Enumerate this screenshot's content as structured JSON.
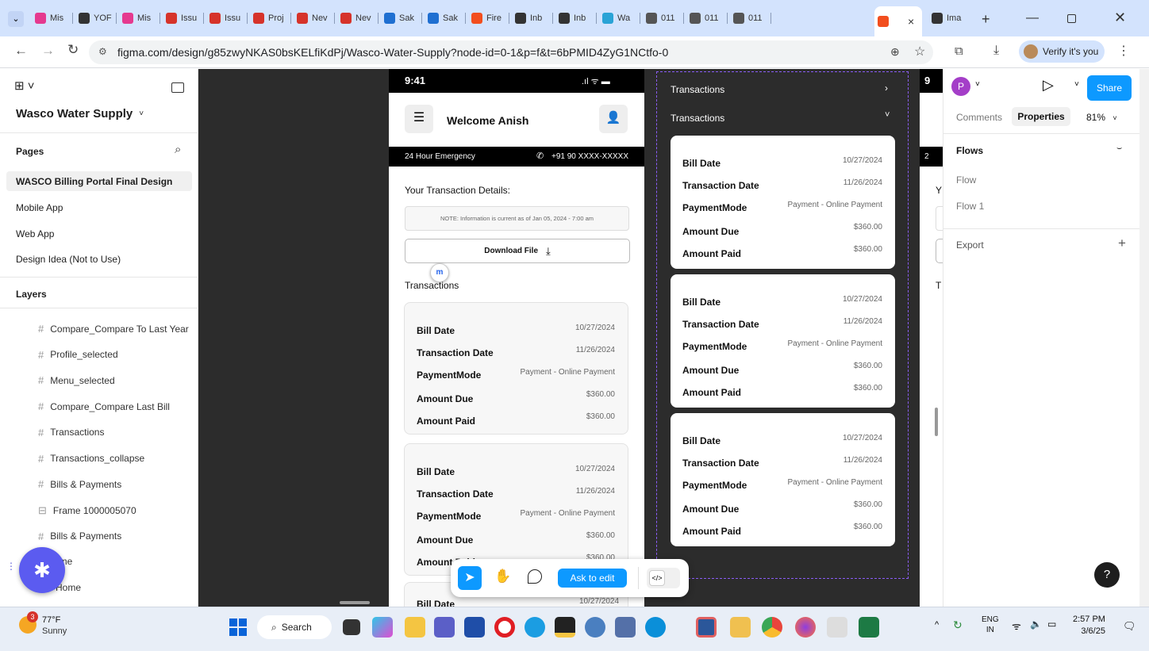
{
  "browser": {
    "tabs": [
      {
        "label": "Mis",
        "color": "#e5398f"
      },
      {
        "label": "YOF",
        "color": "#333333"
      },
      {
        "label": "Mis",
        "color": "#e5398f"
      },
      {
        "label": "Issu",
        "color": "#d6332a"
      },
      {
        "label": "Issu",
        "color": "#d6332a"
      },
      {
        "label": "Proj",
        "color": "#d6332a"
      },
      {
        "label": "Nev",
        "color": "#d6332a"
      },
      {
        "label": "Nev",
        "color": "#d6332a"
      },
      {
        "label": "Sak",
        "color": "#1f6fd1"
      },
      {
        "label": "Sak",
        "color": "#1f6fd1"
      },
      {
        "label": "Fire",
        "color": "#f24e1e"
      },
      {
        "label": "Inb",
        "color": "#333333"
      },
      {
        "label": "Inb",
        "color": "#333333"
      },
      {
        "label": "Wa",
        "color": "#2aa3d6"
      },
      {
        "label": "011",
        "color": "#555555"
      },
      {
        "label": "011",
        "color": "#555555"
      },
      {
        "label": "011",
        "color": "#555555"
      },
      {
        "label": "",
        "color": "#f24e1e"
      },
      {
        "label": "Ima",
        "color": "#333333"
      }
    ],
    "active_tab_close": "×",
    "new_tab": "+",
    "url": "figma.com/design/g85zwyNKAS0bsKELfiKdPj/Wasco-Water-Supply?node-id=0-1&p=f&t=6bPMID4ZyG1NCtfo-0",
    "verify_label": "Verify it's you"
  },
  "left_panel": {
    "file_name": "Wasco Water Supply",
    "pages_label": "Pages",
    "pages": [
      "WASCO Billing Portal Final Design",
      "Mobile App",
      "Web App",
      "Design Idea (Not to Use)"
    ],
    "layers_label": "Layers",
    "layers": [
      "Compare_Compare To Last Year",
      "Profile_selected",
      "Menu_selected",
      "Compare_Compare Last Bill",
      "Transactions",
      "Transactions_collapse",
      "Bills & Payments",
      "Frame 1000005070",
      "Bills & Payments",
      "ome",
      "Home"
    ]
  },
  "phone": {
    "time": "9:41",
    "welcome": "Welcome Anish",
    "emergency_label": "24 Hour Emergency",
    "emergency_phone": "+91 90 XXXX-XXXXX",
    "section_title": "Your Transaction Details:",
    "note": "NOTE: Information is current as of Jan 05, 2024 - 7:00 am",
    "download_label": "Download File",
    "transactions_label": "Transactions",
    "cards": [
      {
        "bill_date_label": "Bill Date",
        "bill_date": "10/27/2024",
        "txn_date_label": "Transaction Date",
        "txn_date": "11/26/2024",
        "mode_label": "PaymentMode",
        "mode": "Payment - Online Payment",
        "due_label": "Amount Due",
        "due": "$360.00",
        "paid_label": "Amount Paid",
        "paid": "$360.00"
      },
      {
        "bill_date_label": "Bill Date",
        "bill_date": "10/27/2024",
        "txn_date_label": "Transaction Date",
        "txn_date": "11/26/2024",
        "mode_label": "PaymentMode",
        "mode": "Payment - Online Payment",
        "due_label": "Amount Due",
        "due": "$360.00",
        "paid_label": "Amount Paid",
        "paid": "$360.00"
      }
    ],
    "partial_bill_label": "Bill Date",
    "partial_bill_date": "10/27/2024"
  },
  "frame2": {
    "header1": "Transactions",
    "header2": "Transactions",
    "cards": [
      {
        "bill_date_label": "Bill Date",
        "bill_date": "10/27/2024",
        "txn_date_label": "Transaction Date",
        "txn_date": "11/26/2024",
        "mode_label": "PaymentMode",
        "mode": "Payment - Online Payment",
        "due_label": "Amount Due",
        "due": "$360.00",
        "paid_label": "Amount Paid",
        "paid": "$360.00"
      },
      {
        "bill_date_label": "Bill Date",
        "bill_date": "10/27/2024",
        "txn_date_label": "Transaction Date",
        "txn_date": "11/26/2024",
        "mode_label": "PaymentMode",
        "mode": "Payment - Online Payment",
        "due_label": "Amount Due",
        "due": "$360.00",
        "paid_label": "Amount Paid",
        "paid": "$360.00"
      },
      {
        "bill_date_label": "Bill Date",
        "bill_date": "10/27/2024",
        "txn_date_label": "Transaction Date",
        "txn_date": "11/26/2024",
        "mode_label": "PaymentMode",
        "mode": "Payment - Online Payment",
        "due_label": "Amount Due",
        "due": "$360.00",
        "paid_label": "Amount Paid",
        "paid": "$360.00"
      }
    ]
  },
  "frame3": {
    "time_partial": "9",
    "emergency_partial": "2",
    "title_partial": "Y",
    "trans_partial": "T"
  },
  "bottom_toolbar": {
    "ask_to_edit": "Ask to edit",
    "code_icon": "</>"
  },
  "right_panel": {
    "avatar": "P",
    "share": "Share",
    "tab_comments": "Comments",
    "tab_properties": "Properties",
    "zoom": "81%",
    "flows_label": "Flows",
    "flows": [
      "Flow",
      "Flow 1"
    ],
    "export_label": "Export",
    "help": "?"
  },
  "taskbar": {
    "weather_temp": "77°F",
    "weather_desc": "Sunny",
    "weather_badge": "3",
    "search_label": "Search",
    "lang1": "ENG",
    "lang2": "IN",
    "time": "2:57 PM",
    "date": "3/6/25"
  },
  "colors": {
    "accent": "#0d99ff",
    "frame_border": "#8a5cf6",
    "canvas": "#2c2c2c"
  }
}
